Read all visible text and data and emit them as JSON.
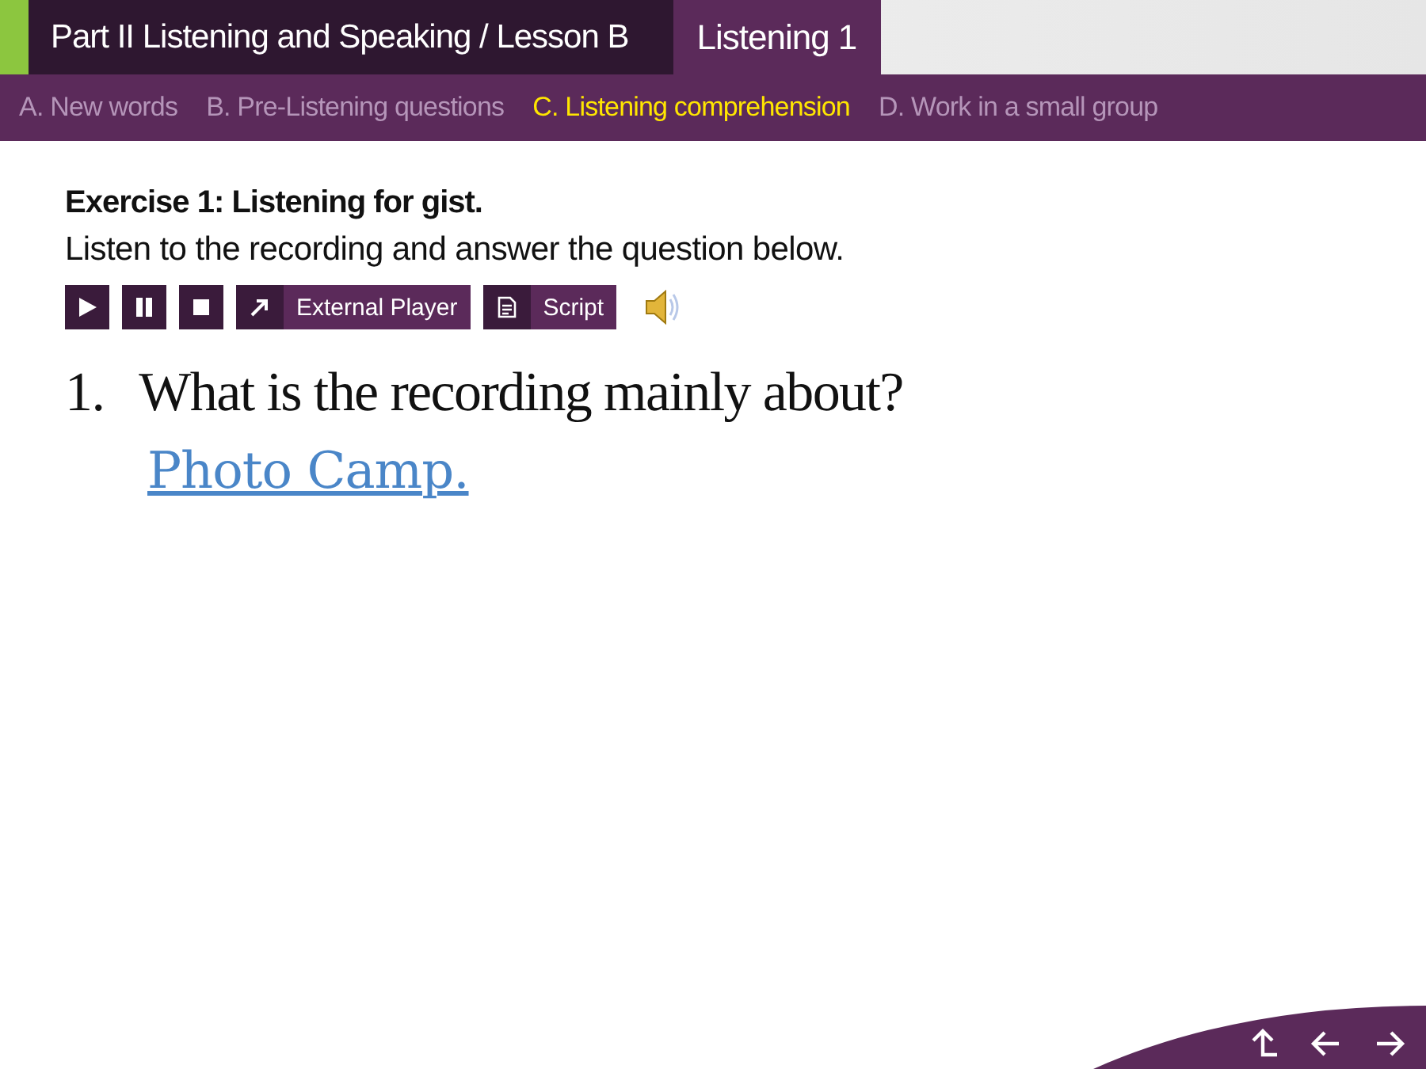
{
  "header": {
    "title": "Part II Listening  and Speaking / Lesson B",
    "tab": "Listening 1"
  },
  "nav": [
    {
      "label": "A. New words",
      "selected": false
    },
    {
      "label": "B. Pre-Listening questions",
      "selected": false
    },
    {
      "label": "C. Listening comprehension",
      "selected": true
    },
    {
      "label": "D. Work in a small group",
      "selected": false
    }
  ],
  "exercise": {
    "title": "Exercise 1: Listening for gist.",
    "instruction": "Listen to the recording and answer the question below."
  },
  "controls": [
    {
      "kind": "play"
    },
    {
      "kind": "pause"
    },
    {
      "kind": "stop"
    },
    {
      "kind": "external",
      "label": "External Player"
    },
    {
      "kind": "script",
      "label": "Script"
    },
    {
      "kind": "speaker"
    }
  ],
  "question": {
    "number": "1.",
    "text": "What is the recording mainly about?",
    "answer": "Photo Camp."
  }
}
